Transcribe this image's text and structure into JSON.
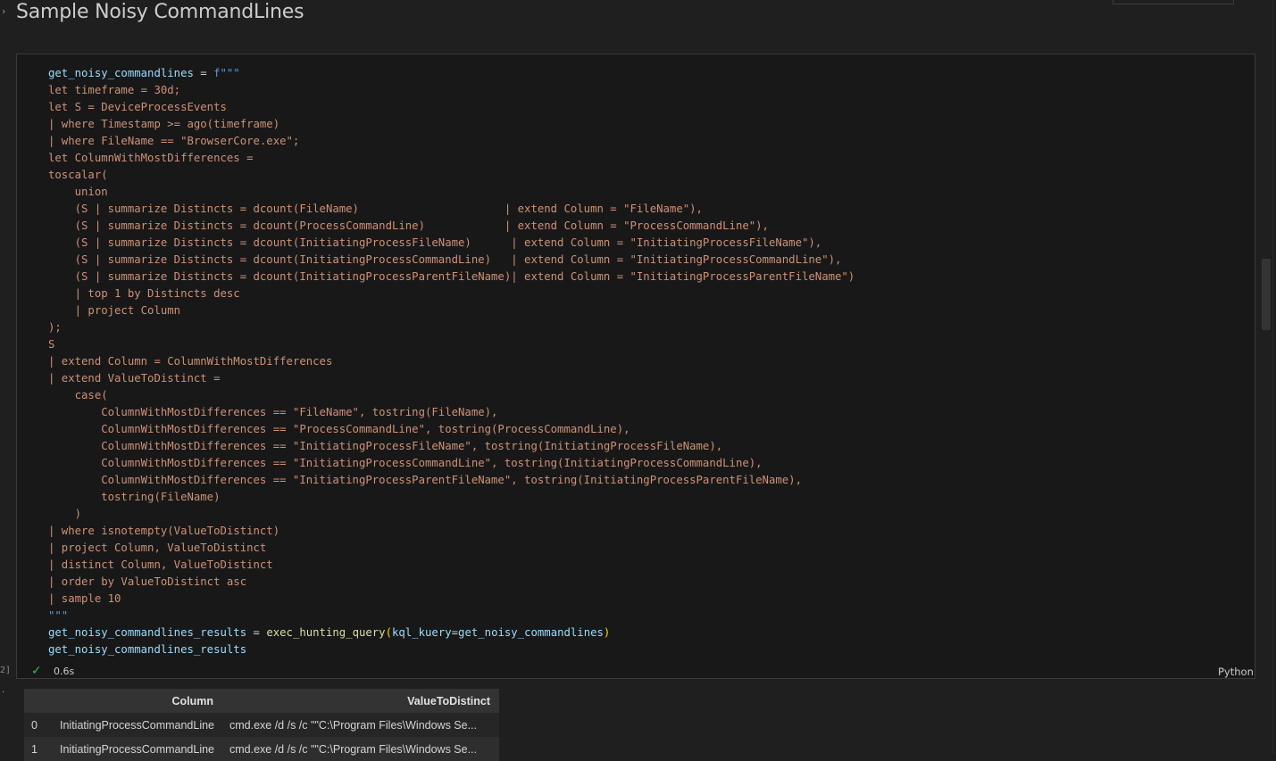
{
  "section": {
    "chevron": "›",
    "title": "Sample Noisy CommandLines"
  },
  "cell": {
    "exec_count": "2]",
    "status_duration": "0.6s",
    "language": "Python",
    "code_lines": [
      [
        [
          "get_noisy_commandlines",
          "#9cdcfe"
        ],
        [
          " = ",
          "#cccccc"
        ],
        [
          "f\"\"\"",
          "#569cd6"
        ]
      ],
      [
        [
          "let timeframe = 30d;",
          "#ce9178"
        ]
      ],
      [
        [
          "let S = DeviceProcessEvents",
          "#ce9178"
        ]
      ],
      [
        [
          "| where Timestamp >= ago(timeframe)",
          "#ce9178"
        ]
      ],
      [
        [
          "| where FileName == \"BrowserCore.exe\";",
          "#ce9178"
        ]
      ],
      [
        [
          "let ColumnWithMostDifferences =",
          "#ce9178"
        ]
      ],
      [
        [
          "toscalar(",
          "#ce9178"
        ]
      ],
      [
        [
          "    union",
          "#ce9178"
        ]
      ],
      [
        [
          "    (S | summarize Distincts = dcount(FileName)                      | extend Column = \"FileName\"),",
          "#ce9178"
        ]
      ],
      [
        [
          "    (S | summarize Distincts = dcount(ProcessCommandLine)            | extend Column = \"ProcessCommandLine\"),",
          "#ce9178"
        ]
      ],
      [
        [
          "    (S | summarize Distincts = dcount(InitiatingProcessFileName)      | extend Column = \"InitiatingProcessFileName\"),",
          "#ce9178"
        ]
      ],
      [
        [
          "    (S | summarize Distincts = dcount(InitiatingProcessCommandLine)   | extend Column = \"InitiatingProcessCommandLine\"),",
          "#ce9178"
        ]
      ],
      [
        [
          "    (S | summarize Distincts = dcount(InitiatingProcessParentFileName)| extend Column = \"InitiatingProcessParentFileName\")",
          "#ce9178"
        ]
      ],
      [
        [
          "    | top 1 by Distincts desc",
          "#ce9178"
        ]
      ],
      [
        [
          "    | project Column",
          "#ce9178"
        ]
      ],
      [
        [
          ");",
          "#ce9178"
        ]
      ],
      [
        [
          "S",
          "#ce9178"
        ]
      ],
      [
        [
          "| extend Column = ColumnWithMostDifferences",
          "#ce9178"
        ]
      ],
      [
        [
          "| extend ValueToDistinct =",
          "#ce9178"
        ]
      ],
      [
        [
          "    case(",
          "#ce9178"
        ]
      ],
      [
        [
          "        ColumnWithMostDifferences == \"FileName\", tostring(FileName),",
          "#ce9178"
        ]
      ],
      [
        [
          "        ColumnWithMostDifferences == \"ProcessCommandLine\", tostring(ProcessCommandLine),",
          "#ce9178"
        ]
      ],
      [
        [
          "        ColumnWithMostDifferences == \"InitiatingProcessFileName\", tostring(InitiatingProcessFileName),",
          "#ce9178"
        ]
      ],
      [
        [
          "        ColumnWithMostDifferences == \"InitiatingProcessCommandLine\", tostring(InitiatingProcessCommandLine),",
          "#ce9178"
        ]
      ],
      [
        [
          "        ColumnWithMostDifferences == \"InitiatingProcessParentFileName\", tostring(InitiatingProcessParentFileName),",
          "#ce9178"
        ]
      ],
      [
        [
          "        tostring(FileName)",
          "#ce9178"
        ]
      ],
      [
        [
          "    )",
          "#ce9178"
        ]
      ],
      [
        [
          "| where isnotempty(ValueToDistinct)",
          "#ce9178"
        ]
      ],
      [
        [
          "| project Column, ValueToDistinct",
          "#ce9178"
        ]
      ],
      [
        [
          "| distinct Column, ValueToDistinct",
          "#ce9178"
        ]
      ],
      [
        [
          "| order by ValueToDistinct asc",
          "#ce9178"
        ]
      ],
      [
        [
          "| sample 10",
          "#ce9178"
        ]
      ],
      [
        [
          "\"\"\"",
          "#569cd6"
        ]
      ],
      [
        [
          "get_noisy_commandlines_results",
          "#9cdcfe"
        ],
        [
          " = ",
          "#cccccc"
        ],
        [
          "exec_hunting_query",
          "#dcdcaa"
        ],
        [
          "(",
          "#ffd700"
        ],
        [
          "kql_kuery",
          "#9cdcfe"
        ],
        [
          "=",
          "#cccccc"
        ],
        [
          "get_noisy_commandlines",
          "#9cdcfe"
        ],
        [
          ")",
          "#ffd700"
        ]
      ],
      [
        [
          "get_noisy_commandlines_results",
          "#9cdcfe"
        ]
      ]
    ]
  },
  "output": {
    "marker": ".",
    "headers": [
      "",
      "Column",
      "ValueToDistinct"
    ],
    "rows": [
      [
        "0",
        "InitiatingProcessCommandLine",
        "cmd.exe /d /s /c \"\"C:\\Program Files\\Windows Se..."
      ],
      [
        "1",
        "InitiatingProcessCommandLine",
        "cmd.exe /d /s /c \"\"C:\\Program Files\\Windows Se..."
      ]
    ]
  }
}
